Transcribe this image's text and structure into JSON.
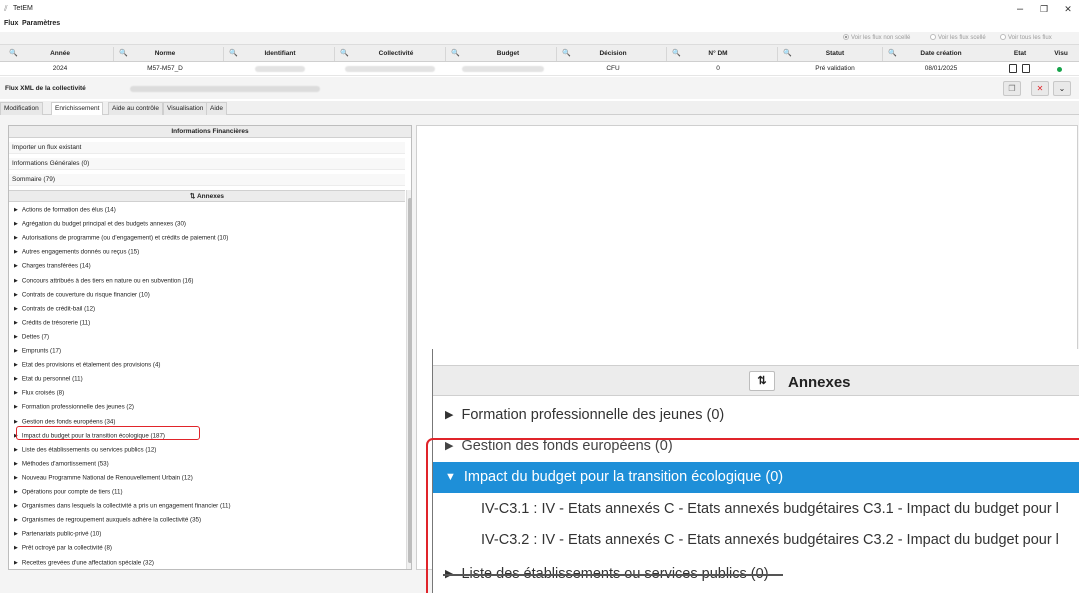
{
  "window": {
    "title": "TetEM",
    "minimize": "–",
    "maximize": "❐",
    "close": "✕"
  },
  "menu": [
    "Flux",
    "Paramètres"
  ],
  "filters": [
    {
      "label": "Voir les flux non scellé",
      "selected": true
    },
    {
      "label": "Voir les flux scellé",
      "selected": false
    },
    {
      "label": "Voir tous les flux",
      "selected": false
    }
  ],
  "table": {
    "columns": [
      "Année",
      "Norme",
      "Identifiant",
      "Collectivité",
      "Budget",
      "Décision",
      "N° DM",
      "Statut",
      "Date création",
      "Etat",
      "Visu"
    ],
    "row": {
      "annee": "2024",
      "norme": "M57-M57_D",
      "decision": "CFU",
      "ndm": "0",
      "statut": "Pré validation",
      "date": "08/01/2025"
    },
    "search_glyph": "🔍"
  },
  "xml_bar": {
    "title": "Flux XML de la collectivité",
    "btn_copy": "❐",
    "btn_close": "✕",
    "btn_more": "⌄"
  },
  "tabs": [
    "Modification",
    "Enrichissement",
    "Aide au contrôle",
    "Visualisation",
    "Aide"
  ],
  "left_panel": {
    "header": "Informations Financières",
    "items": [
      "Importer un flux existant",
      "Informations Générales (0)",
      "Sommaire (79)"
    ],
    "annexes_header": "Annexes",
    "sort_glyph": "⇅",
    "annexes": [
      "Actions de formation des élus (14)",
      "Agrégation du budget principal et des budgets annexes (30)",
      "Autorisations de programme (ou d'engagement) et crédits de paiement (10)",
      "Autres engagements donnés ou reçus (15)",
      "Charges transférées (14)",
      "Concours attribués à des tiers en nature ou en subvention (16)",
      "Contrats de couverture du risque financier (10)",
      "Contrats de crédit-bail (12)",
      "Crédits de trésorerie (11)",
      "Dettes (7)",
      "Emprunts (17)",
      "Etat des provisions et étalement des provisions (4)",
      "Etat du personnel (11)",
      "Flux croisés (8)",
      "Formation professionnelle des jeunes (2)",
      "Gestion des fonds européens (34)",
      "Impact du budget pour la transition écologique (187)",
      "Liste des établissements ou services publics (12)",
      "Méthodes d'amortissement (53)",
      "Nouveau Programme National de Renouvellement Urbain (12)",
      "Opérations pour compte de tiers (11)",
      "Organismes dans lesquels la collectivité a pris un engagement financier (11)",
      "Organismes de regroupement auxquels adhère la collectivité (35)",
      "Partenariats public-privé (10)",
      "Prêt octroyé par la collectivité (8)",
      "Recettes grevées d'une affectation spéciale (32)"
    ]
  },
  "zoom": {
    "header": "Annexes",
    "sort_glyph": "⇅",
    "rows": [
      {
        "label": "Formation professionnelle des jeunes (0)",
        "expanded": false
      },
      {
        "label": "Gestion des fonds européens (0)",
        "expanded": false
      },
      {
        "label": "Impact du budget pour la transition écologique (0)",
        "expanded": true
      }
    ],
    "children": [
      "IV-C3.1 : IV - Etats annexés C - Etats annexés budgétaires C3.1 - Impact du budget pour l",
      "IV-C3.2 : IV - Etats annexés C - Etats annexés budgétaires C3.2 - Impact du budget pour l"
    ],
    "last_row": "Liste des établissements ou services publics (0)"
  },
  "colors": {
    "highlight": "#e0242a",
    "selection": "#1e8fd8",
    "status_ok": "#16a34a"
  }
}
